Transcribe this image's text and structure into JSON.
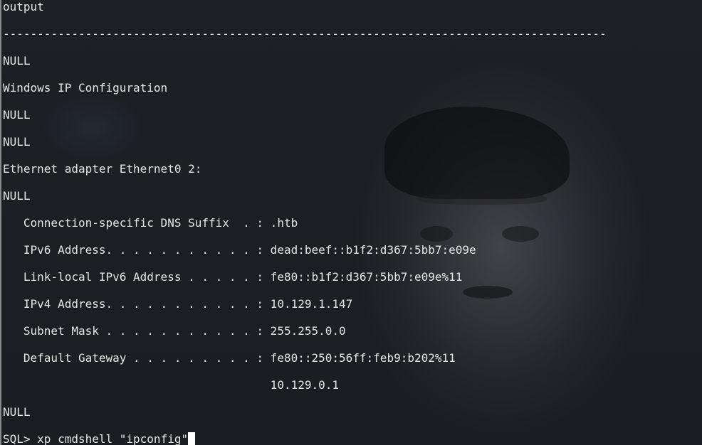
{
  "terminal": {
    "lines": [
      "output",
      "----------------------------------------------------------------------------------------",
      "NULL",
      "Windows IP Configuration",
      "NULL",
      "NULL",
      "Ethernet adapter Ethernet0 2:",
      "NULL",
      "   Connection-specific DNS Suffix  . : .htb",
      "   IPv6 Address. . . . . . . . . . . : dead:beef::b1f2:d367:5bb7:e09e",
      "   Link-local IPv6 Address . . . . . : fe80::b1f2:d367:5bb7:e09e%11",
      "   IPv4 Address. . . . . . . . . . . : 10.129.1.147",
      "   Subnet Mask . . . . . . . . . . . : 255.255.0.0",
      "   Default Gateway . . . . . . . . . : fe80::250:56ff:feb9:b202%11",
      "                                       10.129.0.1",
      "NULL"
    ],
    "prompt": "SQL> ",
    "command": "xp_cmdshell \"ipconfig\""
  }
}
